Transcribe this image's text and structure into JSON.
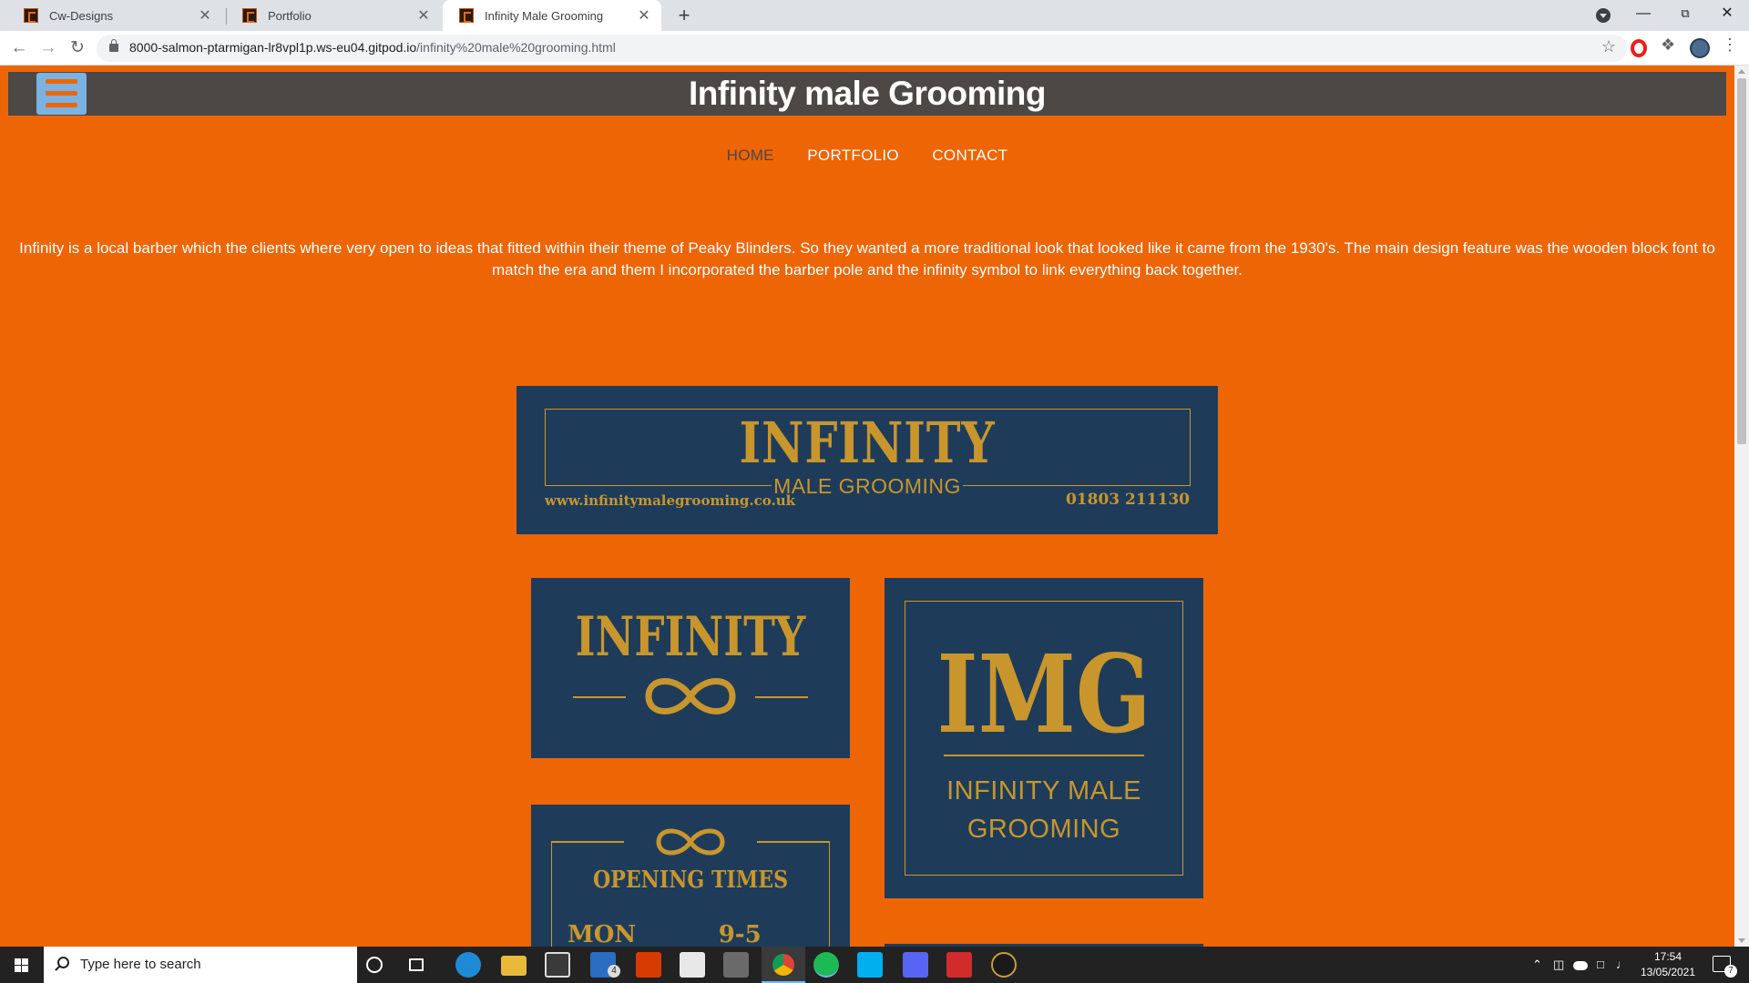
{
  "browser": {
    "tabs": [
      {
        "title": "Cw-Designs"
      },
      {
        "title": "Portfolio"
      },
      {
        "title": "Infinity Male Grooming"
      }
    ],
    "tab_close_glyph": "✕",
    "new_tab_glyph": "+",
    "url_host": "8000-salmon-ptarmigan-lr8vpl1p.ws-eu04.gitpod.io",
    "url_path": "/infinity%20male%20grooming.html"
  },
  "site": {
    "title": "Infinity male Grooming",
    "nav": [
      {
        "label": "HOME"
      },
      {
        "label": "PORTFOLIO"
      },
      {
        "label": "CONTACT"
      }
    ],
    "intro": "Infinity is a local barber which the clients where very open to ideas that fitted within their theme of Peaky Blinders. So they wanted a more traditional look that looked like it came from the 1930's. The main design feature was the wooden block font to match the era and them I incorporated the barber pole and the infinity symbol to link everything back together."
  },
  "gallery": {
    "business_card": {
      "name": "INFINITY",
      "sub": "MALE GROOMING",
      "website": "www.infinitymalegrooming.co.uk",
      "phone": "01803 211130"
    },
    "logo_card": {
      "name": "INFINITY"
    },
    "monogram_card": {
      "monogram": "IMG",
      "sub_line1": "INFINITY MALE",
      "sub_line2": "GROOMING"
    },
    "times_card": {
      "title": "OPENING TIMES",
      "row": "MON          9-5"
    }
  },
  "taskbar": {
    "search_placeholder": "Type here to search",
    "time": "17:54",
    "date": "13/05/2021",
    "notification_count": "7",
    "mail_badge": "4"
  },
  "colors": {
    "page_bg": "#ee6506",
    "header_bg": "#4b4846",
    "card_bg": "#1e3c5a",
    "gold": "#c8962c",
    "hamburger_bg": "#7bb2e2"
  }
}
